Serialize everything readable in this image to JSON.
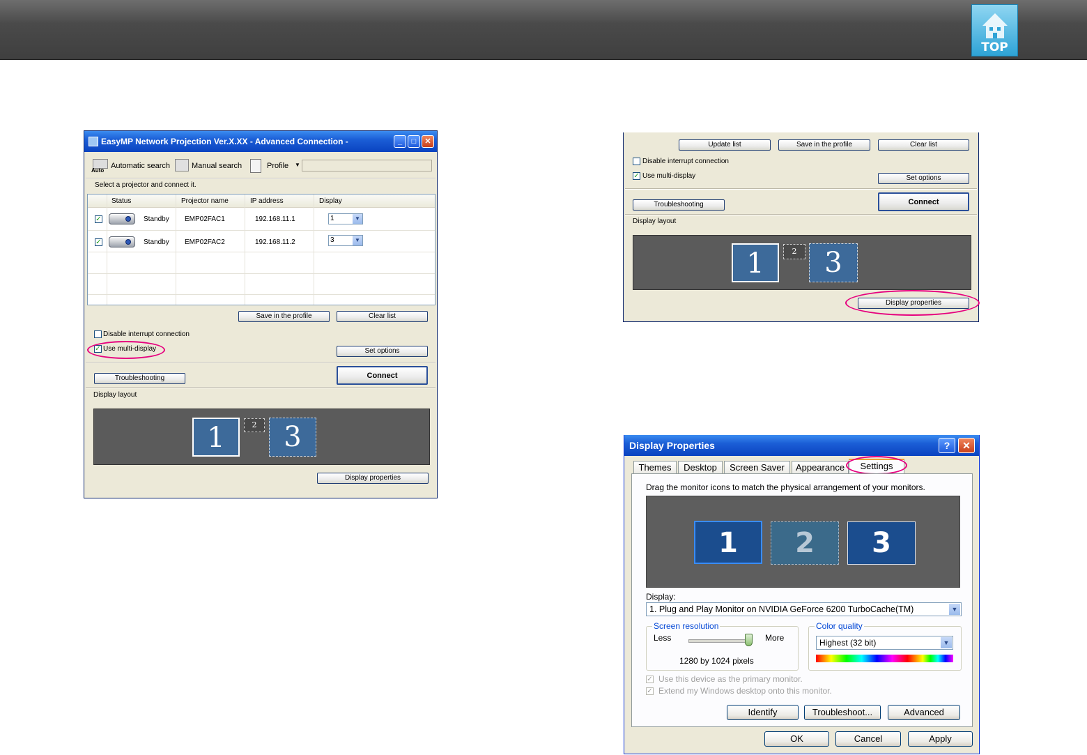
{
  "header": {
    "top_label": "TOP"
  },
  "easymp": {
    "title": "EasyMP Network Projection Ver.X.XX - Advanced Connection -",
    "toolbar": {
      "auto_icon_text": "Auto",
      "automatic_search": "Automatic search",
      "manual_search": "Manual search",
      "profile": "Profile"
    },
    "instruction": "Select a projector and connect it.",
    "columns": [
      "Status",
      "Projector name",
      "IP address",
      "Display"
    ],
    "rows": [
      {
        "status": "Standby",
        "name": "EMP02FAC1",
        "ip": "192.168.11.1",
        "display": "1"
      },
      {
        "status": "Standby",
        "name": "EMP02FAC2",
        "ip": "192.168.11.2",
        "display": "3"
      }
    ],
    "buttons": {
      "save_profile": "Save in the profile",
      "clear_list": "Clear list",
      "set_options": "Set options",
      "connect": "Connect",
      "troubleshooting": "Troubleshooting",
      "display_properties": "Display properties"
    },
    "checkboxes": {
      "disable_interrupt": "Disable interrupt connection",
      "use_multi_display": "Use multi-display"
    },
    "display_layout_label": "Display layout",
    "layout_monitors": [
      "1",
      "2",
      "3"
    ]
  },
  "easymp_partial": {
    "buttons": {
      "update_list": "Update list",
      "save_profile": "Save in the profile",
      "clear_list": "Clear list",
      "set_options": "Set options",
      "connect": "Connect",
      "troubleshooting": "Troubleshooting",
      "display_properties": "Display properties"
    },
    "checkboxes": {
      "disable_interrupt": "Disable interrupt connection",
      "use_multi_display": "Use multi-display"
    },
    "display_layout_label": "Display layout",
    "layout_monitors": [
      "1",
      "2",
      "3"
    ]
  },
  "display_properties": {
    "title": "Display Properties",
    "tabs": [
      "Themes",
      "Desktop",
      "Screen Saver",
      "Appearance",
      "Settings"
    ],
    "instruction": "Drag the monitor icons to match the physical arrangement of your monitors.",
    "monitors": [
      "1",
      "2",
      "3"
    ],
    "display_label": "Display:",
    "display_value": "1. Plug and Play Monitor on NVIDIA GeForce 6200 TurboCache(TM)",
    "screen_resolution": {
      "label": "Screen resolution",
      "less": "Less",
      "more": "More",
      "value": "1280 by 1024 pixels",
      "level": 1.0
    },
    "color_quality": {
      "label": "Color quality",
      "value": "Highest (32 bit)"
    },
    "checkboxes": {
      "primary": "Use this device as the primary monitor.",
      "extend": "Extend my Windows desktop onto this monitor."
    },
    "buttons": {
      "identify": "Identify",
      "troubleshoot": "Troubleshoot...",
      "advanced": "Advanced",
      "ok": "OK",
      "cancel": "Cancel",
      "apply": "Apply"
    }
  }
}
